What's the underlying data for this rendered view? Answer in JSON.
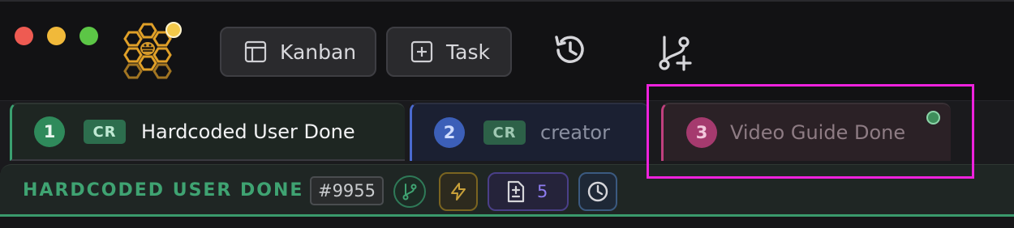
{
  "toolbar": {
    "kanban_label": "Kanban",
    "task_label": "Task",
    "kanban_icon": "layout-icon",
    "task_icon": "plus-square-icon",
    "history_icon": "history-icon",
    "branch_add_icon": "git-branch-plus-icon"
  },
  "tabs": [
    {
      "number": "1",
      "badge": "CR",
      "title": "Hardcoded User Done",
      "accent": "#3aa070",
      "active": true
    },
    {
      "number": "2",
      "badge": "CR",
      "title": "creator",
      "accent": "#4a6ad0",
      "active": false
    },
    {
      "number": "3",
      "badge": "",
      "title": "Video Guide Done",
      "accent": "#c0407e",
      "active": false,
      "status": "online"
    }
  ],
  "info_bar": {
    "title": "HARDCODED USER DONE",
    "issue_number": "#9955",
    "files_count": "5",
    "title_color": "#3fa372"
  }
}
